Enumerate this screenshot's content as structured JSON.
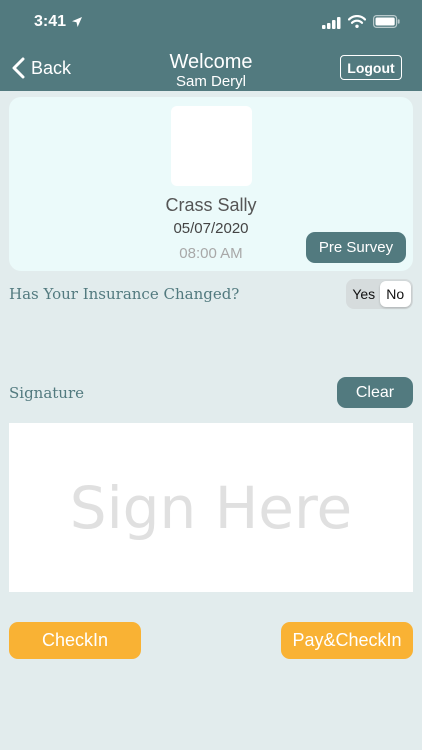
{
  "status_bar": {
    "time": "3:41",
    "icons": [
      "location-arrow-icon",
      "cellular-signal-icon",
      "wifi-icon",
      "battery-icon"
    ]
  },
  "nav": {
    "back_label": "Back",
    "title": "Welcome",
    "subtitle": "Sam Deryl",
    "logout_label": "Logout"
  },
  "patient": {
    "name": "Crass Sally",
    "date": "05/07/2020",
    "time": "08:00 AM",
    "pre_survey_label": "Pre Survey"
  },
  "insurance": {
    "question": "Has Your Insurance Changed?",
    "options": [
      "Yes",
      "No"
    ],
    "selected": "No"
  },
  "signature": {
    "label": "Signature",
    "clear_label": "Clear",
    "placeholder": "Sign Here"
  },
  "actions": {
    "checkin_label": "CheckIn",
    "pay_checkin_label": "Pay&CheckIn"
  },
  "colors": {
    "header": "#527a7f",
    "background": "#e2eced",
    "card": "#ebfafa",
    "accent": "#f9b234"
  }
}
